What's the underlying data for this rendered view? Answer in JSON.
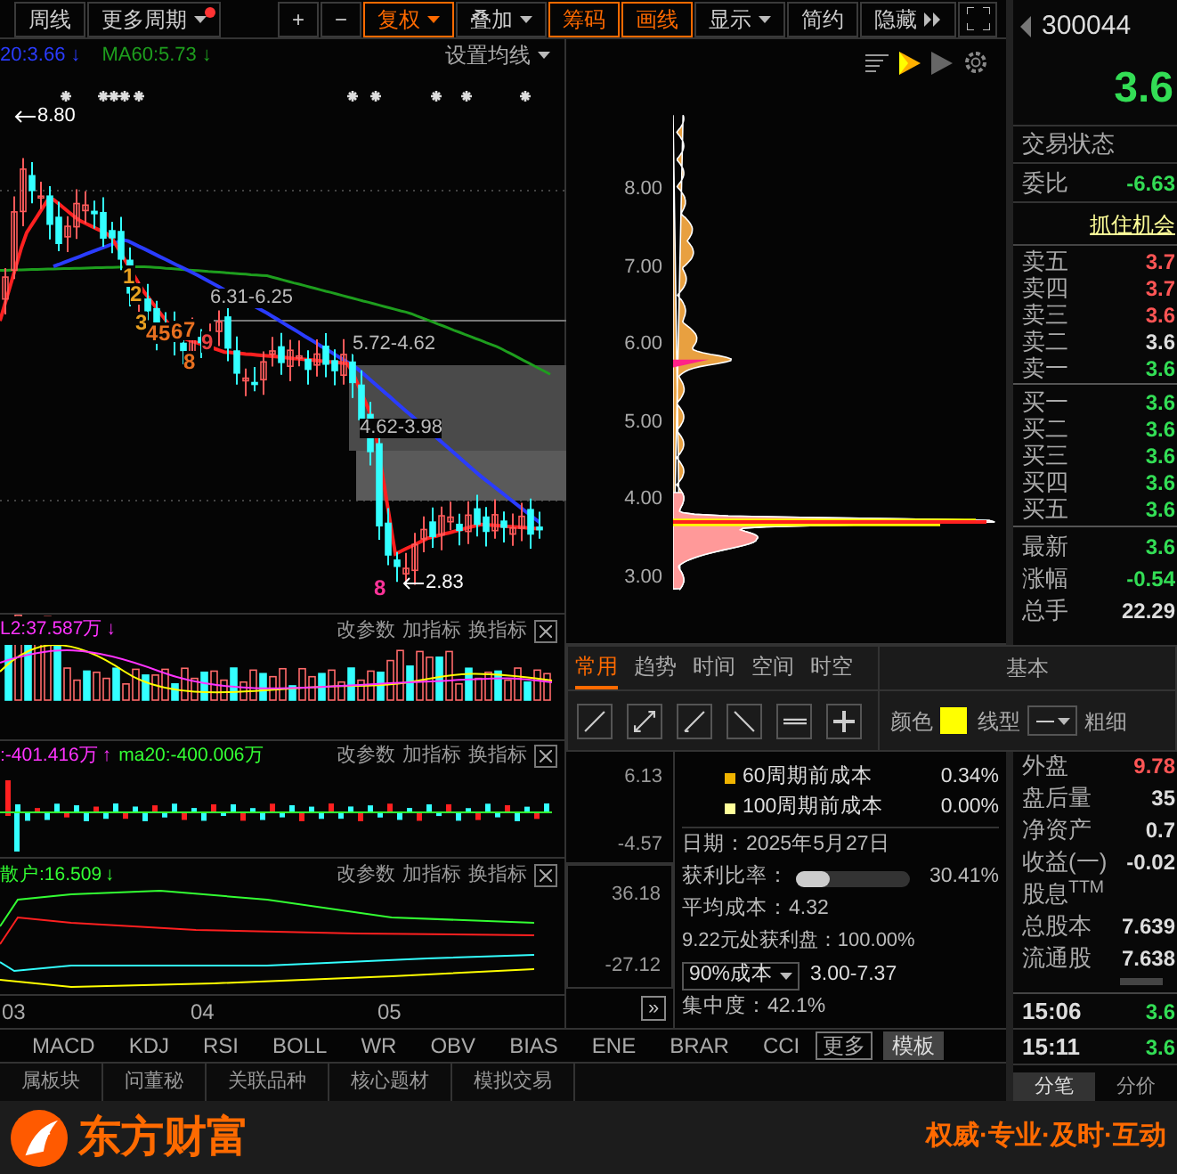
{
  "period_buttons": [
    {
      "label": "周线",
      "kind": "plain",
      "active": false,
      "dot": false
    },
    {
      "label": "更多周期",
      "kind": "dropdown",
      "active": false,
      "dot": true
    }
  ],
  "tool_buttons": [
    {
      "label": "+",
      "kind": "plain",
      "active": false,
      "dot": false
    },
    {
      "label": "−",
      "kind": "plain",
      "active": false,
      "dot": false
    },
    {
      "label": "复权",
      "kind": "dropdown",
      "active": true,
      "dot": false
    },
    {
      "label": "叠加",
      "kind": "dropdown",
      "active": false,
      "dot": false
    },
    {
      "label": "筹码",
      "kind": "plain",
      "active": true,
      "dot": false
    },
    {
      "label": "画线",
      "kind": "plain",
      "active": true,
      "dot": false
    },
    {
      "label": "显示",
      "kind": "dropdown",
      "active": false,
      "dot": false
    },
    {
      "label": "简约",
      "kind": "plain",
      "active": false,
      "dot": false
    },
    {
      "label": "隐藏",
      "kind": "more",
      "active": false,
      "dot": false
    }
  ],
  "main_chart": {
    "legend": [
      {
        "text": "20:3.66",
        "arrow": "↓",
        "color": "#2a3cff"
      },
      {
        "text": "MA60:5.73",
        "arrow": "↓",
        "color": "#1e9e1e"
      }
    ],
    "ma_settings": "设置均线",
    "annotations": [
      {
        "text": "8.80",
        "kind": "arrow"
      },
      {
        "text": "6.31-6.25",
        "kind": "range"
      },
      {
        "text": "5.72-4.62",
        "kind": "range"
      },
      {
        "text": "4.62-3.98",
        "kind": "range"
      },
      {
        "text": "2.83",
        "kind": "arrow"
      }
    ],
    "wave_marks": [
      {
        "text": "1",
        "color": "#e8a020"
      },
      {
        "text": "2",
        "color": "#e8a020"
      },
      {
        "text": "3",
        "color": "#e8a020"
      },
      {
        "text": "4",
        "color": "#e87020"
      },
      {
        "text": "5",
        "color": "#e87020"
      },
      {
        "text": "6",
        "color": "#e87020"
      },
      {
        "text": "7",
        "color": "#e87020"
      },
      {
        "text": "8",
        "color": "#e87020"
      },
      {
        "text": "9",
        "color": "#e84040"
      },
      {
        "text": "8",
        "color": "#ff3399"
      }
    ]
  },
  "chip_chart": {
    "price_ticks": [
      "8.00",
      "7.00",
      "6.00",
      "5.00",
      "4.00",
      "3.00"
    ]
  },
  "panes": [
    {
      "legend": [
        {
          "text": "L2:37.587万",
          "arrow": "↓",
          "color": "#ff33ff"
        }
      ],
      "actions": [
        "改参数",
        "加指标",
        "换指标"
      ]
    },
    {
      "legend": [
        {
          "text": ":-401.416万",
          "arrow": "↑",
          "color": "#ff33ff"
        },
        {
          "text": "ma20:-400.006万",
          "color": "#33ff33"
        }
      ],
      "actions": [
        "改参数",
        "加指标",
        "换指标"
      ],
      "axis": [
        "6.13",
        "-4.57"
      ]
    },
    {
      "legend": [
        {
          "text": "散户:16.509",
          "arrow": "↓",
          "color": "#33ff33"
        }
      ],
      "actions": [
        "改参数",
        "加指标",
        "换指标"
      ],
      "axis": [
        "36.18",
        "-27.12"
      ]
    }
  ],
  "x_axis": [
    "03",
    "04",
    "05"
  ],
  "draw_toolbar": {
    "tabs": [
      {
        "label": "常用",
        "selected": true
      },
      {
        "label": "趋势",
        "selected": false
      },
      {
        "label": "时间",
        "selected": false
      },
      {
        "label": "空间",
        "selected": false
      },
      {
        "label": "时空",
        "selected": false
      }
    ],
    "title": "基本",
    "color_label": "颜色",
    "swatch": {
      "color": "#ffff00"
    },
    "line_type_label": "线型",
    "thickness_label": "粗细"
  },
  "chip_info": {
    "cost_rows": [
      {
        "label": "60周期前成本",
        "value": "0.34%",
        "color": "#f0b400"
      },
      {
        "label": "100周期前成本",
        "value": "0.00%",
        "color": "#ffff99"
      }
    ],
    "date": "日期：2025年5月27日",
    "profit_ratio": {
      "label": "获利比率：",
      "level": 0.3041,
      "value": "30.41%"
    },
    "avg_cost": "平均成本：4.32",
    "profit_at": "9.22元处获利盘：100.00%",
    "cost_select": "90%成本",
    "cost_range": "3.00-7.37",
    "expand_button": "»",
    "concentration": "集中度：42.1%"
  },
  "indicator_tabs": [
    "MACD",
    "KDJ",
    "RSI",
    "BOLL",
    "WR",
    "OBV",
    "BIAS",
    "ENE",
    "BRAR",
    "CCI"
  ],
  "more_button": "更多",
  "template_button": "模板",
  "bottom_tabs": [
    "属板块",
    "问董秘",
    "关联品种",
    "核心题材",
    "模拟交易"
  ],
  "quote": {
    "code": "300044",
    "price": "3.6",
    "status_label": "交易状态",
    "order_ratio": {
      "label": "委比",
      "value": "-6.63"
    },
    "link": "抓住机会",
    "asks": [
      {
        "label": "卖五",
        "price": "3.7",
        "color": "#ff5555"
      },
      {
        "label": "卖四",
        "price": "3.7",
        "color": "#ff5555"
      },
      {
        "label": "卖三",
        "price": "3.6",
        "color": "#ff5555"
      },
      {
        "label": "卖二",
        "price": "3.6",
        "color": "#dddddd"
      },
      {
        "label": "卖一",
        "price": "3.6",
        "color": "#33dd55"
      }
    ],
    "bids": [
      {
        "label": "买一",
        "price": "3.6",
        "color": "#33dd55"
      },
      {
        "label": "买二",
        "price": "3.6",
        "color": "#33dd55"
      },
      {
        "label": "买三",
        "price": "3.6",
        "color": "#33dd55"
      },
      {
        "label": "买四",
        "price": "3.6",
        "color": "#33dd55"
      },
      {
        "label": "买五",
        "price": "3.6",
        "color": "#33dd55"
      }
    ],
    "stats": [
      {
        "label": "最新",
        "value": "3.6",
        "color": "#33dd55"
      },
      {
        "label": "涨幅",
        "value": "-0.54",
        "color": "#33dd55"
      },
      {
        "label": "总手",
        "value": "22.29",
        "color": "#dddddd"
      }
    ],
    "stats2": [
      {
        "label": "外盘",
        "value": "9.78",
        "color": "#ff5555"
      },
      {
        "label": "盘后量",
        "value": "35",
        "color": "#dddddd"
      },
      {
        "label": "净资产",
        "value": "0.7",
        "color": "#dddddd"
      },
      {
        "label": "收益(一)",
        "value": "-0.02",
        "color": "#dddddd"
      },
      {
        "label": "股息$^{TTM}$"
      },
      {
        "label": "总股本",
        "value": "7.639",
        "color": "#dddddd"
      },
      {
        "label": "流通股",
        "value": "7.638",
        "color": "#dddddd"
      }
    ],
    "ticks": [
      {
        "time": "15:06",
        "price": "3.6"
      },
      {
        "time": "15:11",
        "price": "3.6"
      }
    ],
    "detail_tabs": [
      {
        "label": "分笔",
        "selected": true
      },
      {
        "label": "分价",
        "selected": false
      }
    ]
  },
  "footer": {
    "brand": "东方财富",
    "slogan": "权威·专业·及时·互动"
  }
}
